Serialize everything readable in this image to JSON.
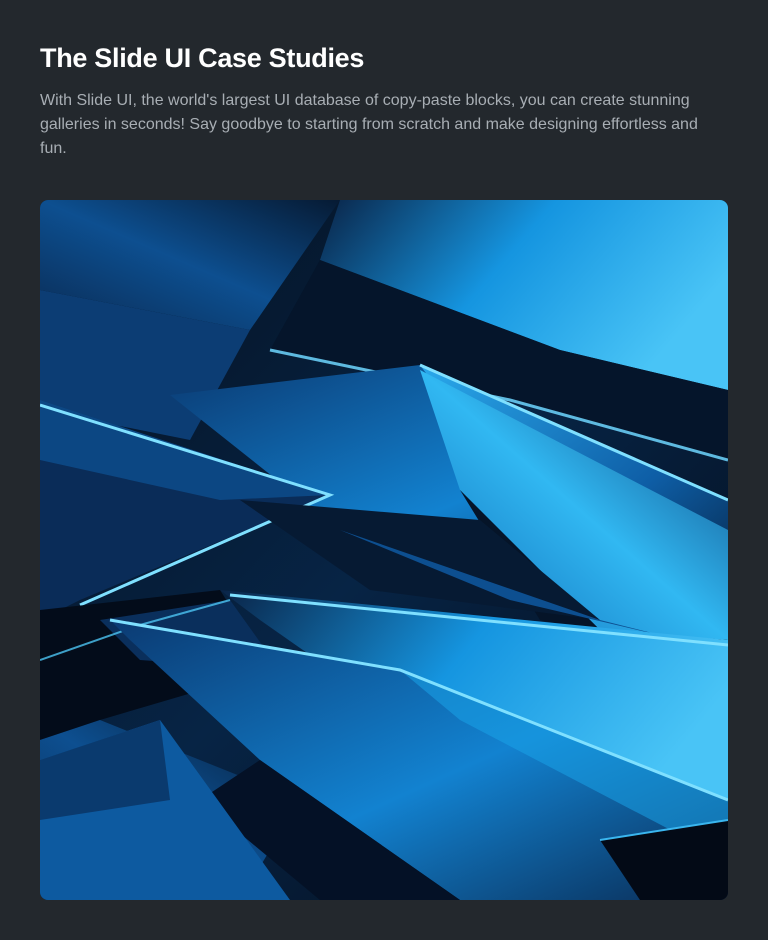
{
  "header": {
    "title": "The Slide UI Case Studies",
    "description": "With Slide UI, the world's largest UI database of copy-paste blocks, you can create stunning galleries in seconds! Say goodbye to starting from scratch and make designing effortless and fun."
  },
  "hero_image": {
    "subject": "abstract-blue-glass-shards",
    "colors": {
      "deep": "#030a16",
      "navy": "#0a2a52",
      "mid": "#0f5fa8",
      "bright": "#1aa3e8",
      "highlight": "#7fe0ff"
    }
  }
}
